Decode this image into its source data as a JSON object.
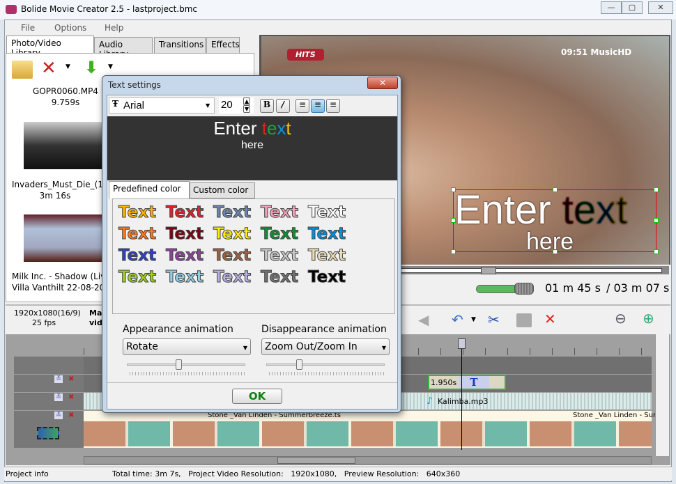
{
  "window": {
    "title": "Bolide Movie Creator 2.5 - lastproject.bmc",
    "controls": [
      "—",
      "▢",
      "✕"
    ]
  },
  "menu": [
    "File",
    "Options",
    "Help"
  ],
  "left_tabs": [
    "Photo/Video Library",
    "Audio Library",
    "Transitions",
    "Effects"
  ],
  "library": [
    {
      "name": "GOPR0060.MP4",
      "duration": "9.759s"
    },
    {
      "name": "Invaders_Must_Die_(1",
      "duration": "3m 16s"
    },
    {
      "name": "Milk Inc. - Shadow (Liv",
      "line2": "Villa Vanthilt 22-08-20"
    }
  ],
  "preview": {
    "overlay_line1_a": "Enter ",
    "overlay_line1_b": "text",
    "overlay_line2": "here",
    "channel_badge": "HITS",
    "channel_logo": "09:51 MusicHD",
    "current_time": "01 m 45 s",
    "total_time": "/ 03 m 07 s",
    "volume_percent": 100,
    "seek_fraction": 0.56
  },
  "info": {
    "resolution": "1920x1080(16/9)",
    "fps": "25 fps",
    "truncated_label_1": "Ma",
    "truncated_label_2": "vid"
  },
  "timeline": {
    "text_clip_duration": "1.950s",
    "audio_clip": "Kalimba.mp3",
    "video_clip_1": "Stone _Van Linden - Summerbreeze.ts",
    "video_clip_2": "Stone _Van Linden - Sum"
  },
  "status": {
    "left": "Project info",
    "right": "Total time: 3m 7s,   Project Video Resolution:   1920x1080,   Preview Resolution:   640x360"
  },
  "dialog": {
    "title": "Text settings",
    "font": "Arial",
    "size": "20",
    "preview_a": "Enter ",
    "preview_t": "t",
    "preview_e": "e",
    "preview_x": "x",
    "preview_t2": "t",
    "preview_line2": "here",
    "tabs": [
      "Predefined color",
      "Custom color"
    ],
    "swatch_label": "Text",
    "swatches": [
      "#ffb300",
      "#e0202a",
      "#6a85b0",
      "#f2a0b8",
      "#ffffff",
      "#ff7a20",
      "#800010",
      "#ffee00",
      "#109030",
      "#0090e0",
      "#3040c0",
      "#9040a0",
      "#a06040",
      "#c8c8c8",
      "#e8dcb0",
      "#a0d020",
      "#90d0e8",
      "#b8b0e0",
      "#707070",
      "#000000"
    ],
    "appearance_label": "Appearance animation",
    "appearance_value": "Rotate",
    "appearance_speed": 0.5,
    "disappearance_label": "Disappearance animation",
    "disappearance_value": "Zoom Out/Zoom In",
    "disappearance_speed": 0.25,
    "ok": "OK"
  }
}
